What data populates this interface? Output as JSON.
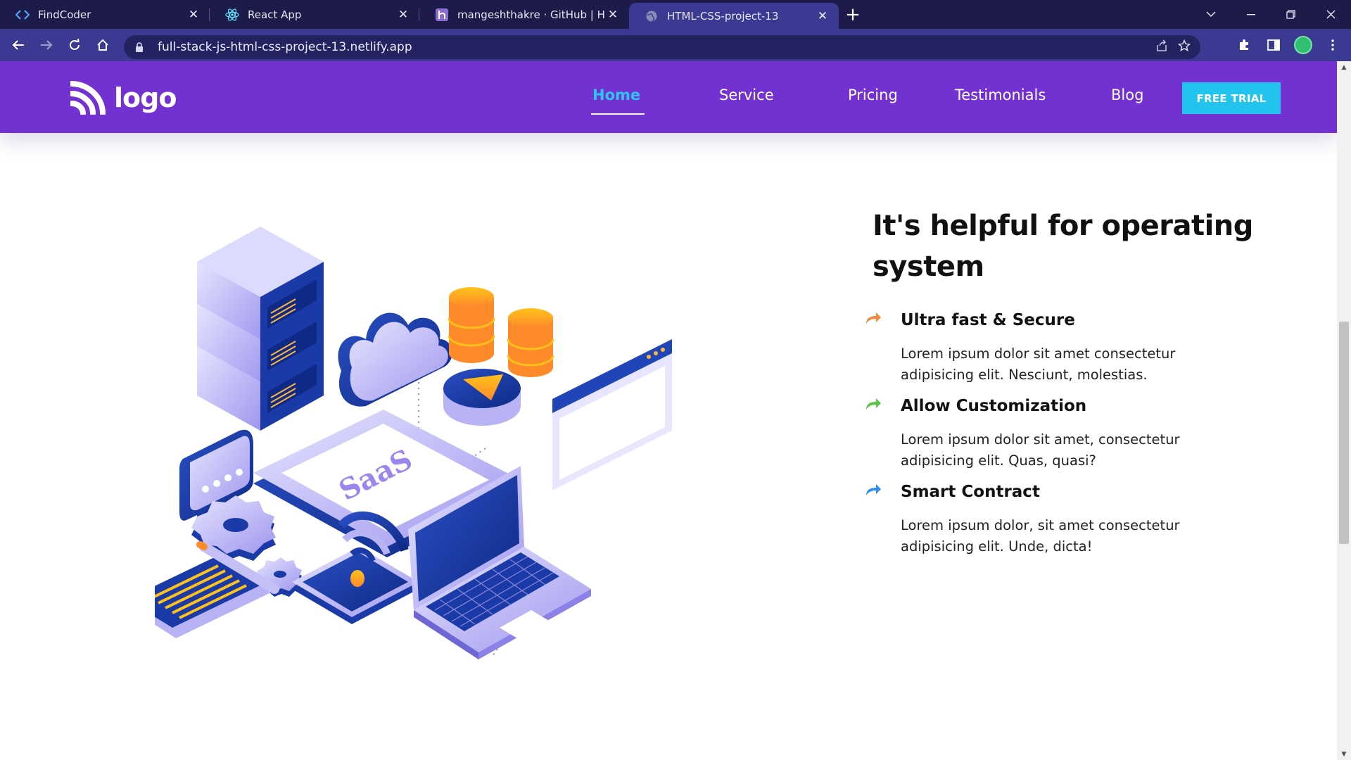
{
  "browser": {
    "tabs": [
      {
        "title": "FindCoder",
        "icon": "code-brackets-icon",
        "active": false
      },
      {
        "title": "React App",
        "icon": "react-icon",
        "active": false
      },
      {
        "title": "mangeshthakre · GitHub | Heroku",
        "icon": "heroku-icon",
        "active": false
      },
      {
        "title": "HTML-CSS-project-13",
        "icon": "globe-icon",
        "active": true
      }
    ],
    "url": "full-stack-js-html-css-project-13.netlify.app"
  },
  "site": {
    "logo_text": "logo",
    "nav": [
      {
        "label": "Home",
        "active": true
      },
      {
        "label": "Service",
        "active": false
      },
      {
        "label": "Pricing",
        "active": false
      },
      {
        "label": "Testimonials",
        "active": false
      },
      {
        "label": "Blog",
        "active": false
      }
    ],
    "cta_label": "FREE TRIAL"
  },
  "section": {
    "heading": "It's helpful for operating system",
    "illustration_label": "SaaS",
    "features": [
      {
        "title": "Ultra fast & Secure",
        "desc": "Lorem ipsum dolor sit amet consectetur adipisicing elit. Nesciunt, molestias.",
        "icon_color": "#f28a3c"
      },
      {
        "title": "Allow Customization",
        "desc": "Lorem ipsum dolor sit amet, consectetur adipisicing elit. Quas, quasi?",
        "icon_color": "#5cc24a"
      },
      {
        "title": "Smart Contract",
        "desc": "Lorem ipsum dolor, sit amet consectetur adipisicing elit. Unde, dicta!",
        "icon_color": "#2f8ff0"
      }
    ]
  },
  "colors": {
    "nav_bg": "#7431d1",
    "accent": "#2ec5f3",
    "cta_bg": "#22c4ee",
    "chrome_bg": "#1c1b4a",
    "toolbar_bg": "#3a3a92"
  }
}
